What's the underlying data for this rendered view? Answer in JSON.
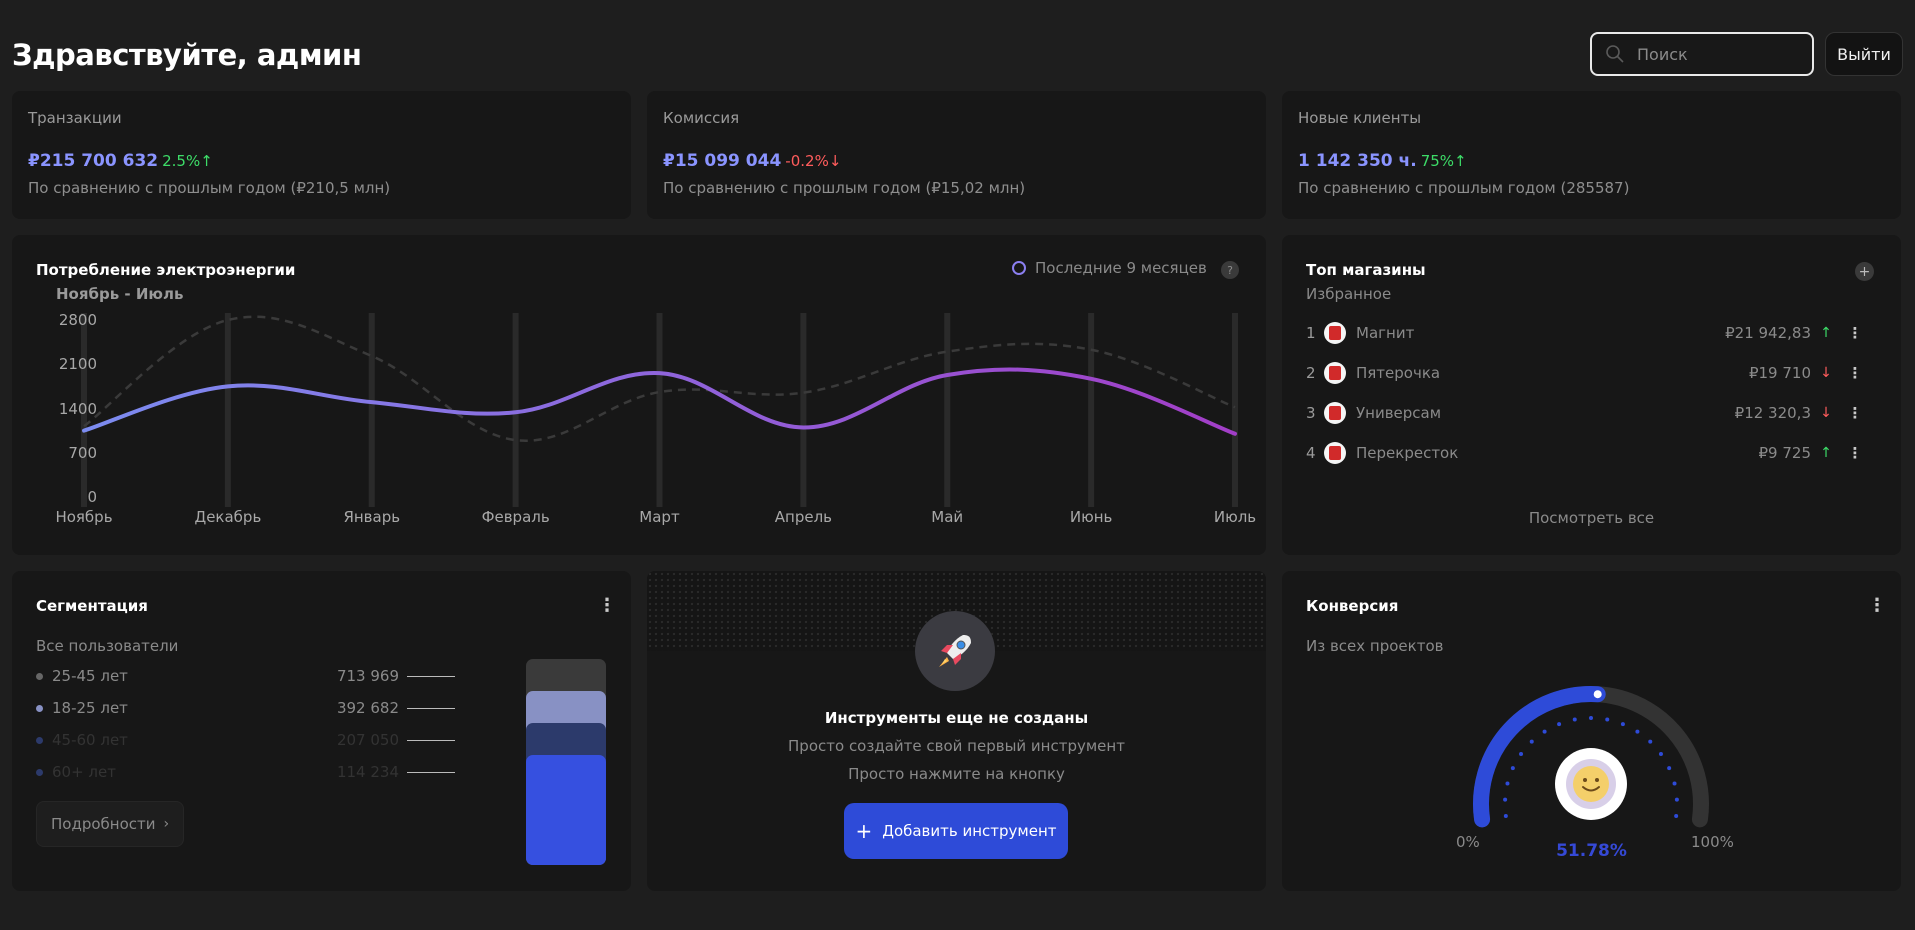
{
  "header": {
    "greeting": "Здравствуйте, админ",
    "search_placeholder": "Поиск",
    "logout_label": "Выйти"
  },
  "stats": [
    {
      "title": "Транзакции",
      "value": "₽215 700 632",
      "delta": "2.5%",
      "trend": "up",
      "comparison": "По сравнению с прошлым годом (₽210,5 млн)"
    },
    {
      "title": "Комиссия",
      "value": "₽15 099 044",
      "delta": "-0.2%",
      "trend": "down",
      "comparison": "По сравнению с прошлым годом (₽15,02 млн)"
    },
    {
      "title": "Новые клиенты",
      "value": "1 142 350 ч.",
      "delta": "75%",
      "trend": "up",
      "comparison": "По сравнению с прошлым годом (285587)"
    }
  ],
  "energy": {
    "title": "Потребление электроэнергии",
    "subtitle": "Ноябрь - Июль",
    "legend": "Последние 9 месяцев",
    "help": "?"
  },
  "chart_data": {
    "type": "line",
    "categories": [
      "Ноябрь",
      "Декабрь",
      "Январь",
      "Февраль",
      "Март",
      "Апрель",
      "Май",
      "Июнь",
      "Июль"
    ],
    "series": [
      {
        "values": [
          1050,
          1750,
          1500,
          1340,
          1960,
          1100,
          1930,
          1870,
          1000
        ],
        "style": "solid",
        "colors": [
          "#7c8cf0",
          "#a23ec7"
        ]
      },
      {
        "values": [
          1120,
          2800,
          2230,
          900,
          1660,
          1650,
          2300,
          2330,
          1420
        ],
        "style": "dashed",
        "colors": [
          "#3a3a3a"
        ]
      }
    ],
    "y_ticks": [
      0,
      700,
      1400,
      2100,
      2800
    ],
    "ylim": [
      0,
      2800
    ],
    "grid": false
  },
  "shops": {
    "title": "Топ магазины",
    "subtitle": "Избранное",
    "add_icon": "+",
    "more_icon": "⋮",
    "items": [
      {
        "rank": "1",
        "name": "Магнит",
        "amount": "₽21 942,83",
        "trend": "up"
      },
      {
        "rank": "2",
        "name": "Пятерочка",
        "amount": "₽19 710",
        "trend": "down"
      },
      {
        "rank": "3",
        "name": "Универсам",
        "amount": "₽12 320,3",
        "trend": "down"
      },
      {
        "rank": "4",
        "name": "Перекресток",
        "amount": "₽9 725",
        "trend": "up"
      }
    ],
    "view_all": "Посмотреть все"
  },
  "segmentation": {
    "title": "Сегментация",
    "subtitle": "Все пользователи",
    "more_icon": "⋮",
    "items": [
      {
        "label": "25-45 лет",
        "value": "713 969",
        "color": "#3a3a3a"
      },
      {
        "label": "18-25 лет",
        "value": "392 682",
        "color": "#8891c4"
      },
      {
        "label": "45-60 лет",
        "value": "207 050",
        "color": "#2c3a6b"
      },
      {
        "label": "60+ лет",
        "value": "114 234",
        "color": "#3650e0"
      }
    ],
    "details_label": "Подробности",
    "details_icon": "›"
  },
  "tools": {
    "title": "Инструменты еще не созданы",
    "line1": "Просто создайте свой первый инструмент",
    "line2": "Просто нажмите на кнопку",
    "button": "Добавить инструмент",
    "button_icon": "+"
  },
  "conversion": {
    "title": "Конверсия",
    "subtitle": "Из всех проектов",
    "more_icon": "⋮",
    "min_label": "0%",
    "max_label": "100%",
    "value": "51.78%",
    "fraction": 0.5178
  },
  "colors": {
    "accent": "#2e4bd8",
    "value_text": "#8a94ff",
    "up": "#3ddc68",
    "down": "#ff5c5c"
  }
}
